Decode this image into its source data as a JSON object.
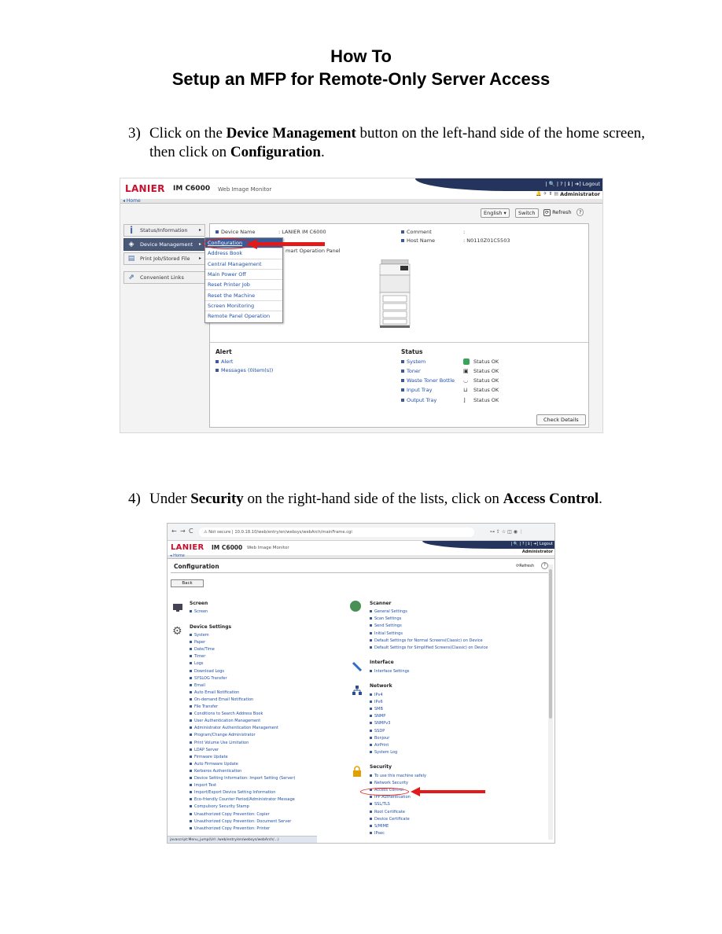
{
  "title_line1": "How To",
  "title_line2": "Setup an MFP for Remote-Only Server Access",
  "steps": [
    {
      "num": "3)",
      "pre": "Click on the ",
      "bold1": "Device Management",
      "mid": " button on the left-hand side of the home screen, then click on ",
      "bold2": "Configuration",
      "post": "."
    },
    {
      "num": "4)",
      "pre": "Under ",
      "bold1": "Security",
      "mid": " on the right-hand side of the lists, click on ",
      "bold2": "Access Control",
      "post": "."
    }
  ],
  "colors": {
    "accent_red": "#e21a1a",
    "header_navy": "#24345c",
    "brand_red": "#c8102e",
    "link_blue": "#1f4fa8"
  },
  "shot1": {
    "brand": "LANIER",
    "model": "IM C6000",
    "app": "Web Image Monitor",
    "header_links": "| 🔍 | ? | ℹ | ➜] Logout",
    "admin": "Administrator",
    "crumb": "◂ Home",
    "language": "English ▾",
    "switch": "Switch",
    "refresh": "Refresh",
    "help": "?",
    "sidebar": [
      "Status/Information",
      "Device Management",
      "Print Job/Stored File",
      "Convenient Links"
    ],
    "menu": [
      "Configuration",
      "Address Book",
      "Central Management",
      "Main Power Off",
      "Reset Printer Job",
      "Reset the Machine",
      "Screen Monitoring",
      "Remote Panel Operation"
    ],
    "device_name_label": "Device Name",
    "device_name_value": ": LANIER IM C6000",
    "partial_text": "mart Operation Panel",
    "comment_label": "Comment",
    "comment_value": ":",
    "host_label": "Host Name",
    "host_value": ": N0110Z01C5503",
    "alert_heading": "Alert",
    "alert_items": [
      "Alert",
      "Messages (0item(s))"
    ],
    "status_heading": "Status",
    "status_items": [
      {
        "label": "System",
        "value": "Status OK"
      },
      {
        "label": "Toner",
        "value": "Status OK"
      },
      {
        "label": "Waste Toner Bottle",
        "value": "Status OK"
      },
      {
        "label": "Input Tray",
        "value": "Status OK"
      },
      {
        "label": "Output Tray",
        "value": "Status OK"
      }
    ],
    "check_details": "Check Details"
  },
  "shot2": {
    "url_warning": "⚠ Not secure",
    "url": "10.0.18.10/web/entry/en/websys/webArch/mainFrame.cgi",
    "brand": "LANIER",
    "model": "IM C6000",
    "app": "Web Image Monitor",
    "header_links": "| 🔍 | ? | ℹ | ➜] Logout",
    "admin": "Administrator",
    "crumb": "◂ Home",
    "page_title": "Configuration",
    "refresh": "Refresh",
    "back": "Back",
    "screen_heading": "Screen",
    "screen_items": [
      "Screen"
    ],
    "device_heading": "Device Settings",
    "device_items": [
      "System",
      "Paper",
      "Date/Time",
      "Timer",
      "Logs",
      "Download Logs",
      "SYSLOG Transfer",
      "Email",
      "Auto Email Notification",
      "On-demand Email Notification",
      "File Transfer",
      "Conditions to Search Address Book",
      "User Authentication Management",
      "Administrator Authentication Management",
      "Program/Change Administrator",
      "Print Volume Use Limitation",
      "LDAP Server",
      "Firmware Update",
      "Auto Firmware Update",
      "Kerberos Authentication",
      "Device Setting Information: Import Setting (Server)",
      "Import Test",
      "Import/Export Device Setting Information",
      "Eco-friendly Counter Period/Administrator Message",
      "Compulsory Security Stamp",
      "Unauthorized Copy Prevention: Copier",
      "Unauthorized Copy Prevention: Document Server",
      "Unauthorized Copy Prevention: Printer"
    ],
    "scanner_heading": "Scanner",
    "scanner_items": [
      "General Settings",
      "Scan Settings",
      "Send Settings",
      "Initial Settings",
      "Default Settings for Normal Screens(Classic) on Device",
      "Default Settings for Simplified Screens(Classic) on Device"
    ],
    "interface_heading": "Interface",
    "interface_items": [
      "Interface Settings"
    ],
    "network_heading": "Network",
    "network_items": [
      "IPv4",
      "IPv6",
      "SMB",
      "SNMP",
      "SNMPv3",
      "SSDP",
      "Bonjour",
      "AirPrint",
      "System Log"
    ],
    "security_heading": "Security",
    "security_items": [
      "To use this machine safely",
      "Network Security",
      "Access Control",
      "IPP Authentication",
      "SSL/TLS",
      "Root Certificate",
      "Device Certificate",
      "S/MIME",
      "IPsec"
    ],
    "status_url": "javascript:Menu_jump(Url: /web/entry/en/websys/webArch/...)"
  }
}
